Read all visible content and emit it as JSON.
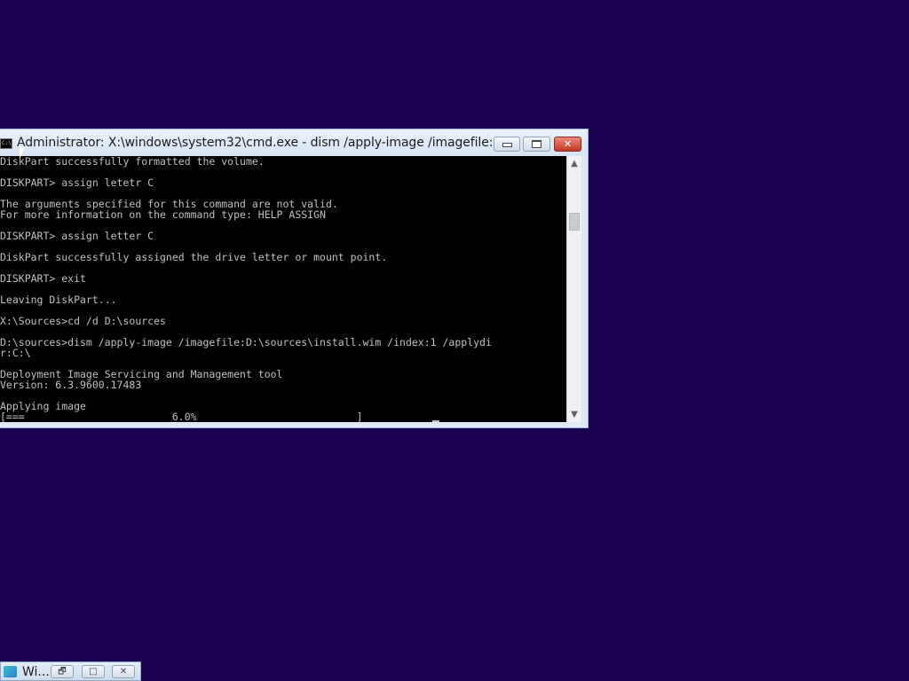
{
  "colors": {
    "desktop_background": "#1c0352",
    "console_background": "#000000",
    "console_text": "#c0c0c0",
    "close_button": "#c4392a"
  },
  "cmd_window": {
    "icon_name": "cmd-icon",
    "icon_label": "C:\\",
    "title": "Administrator: X:\\windows\\system32\\cmd.exe - dism  /apply-image /imagefile:...",
    "buttons": {
      "minimize_icon": "minimize-icon",
      "maximize_icon": "maximize-icon",
      "close_label": "✕"
    },
    "console_lines": [
      "DiskPart successfully formatted the volume.",
      "",
      "DISKPART> assign letetr C",
      "",
      "The arguments specified for this command are not valid.",
      "For more information on the command type: HELP ASSIGN",
      "",
      "DISKPART> assign letter C",
      "",
      "DiskPart successfully assigned the drive letter or mount point.",
      "",
      "DISKPART> exit",
      "",
      "Leaving DiskPart...",
      "",
      "X:\\Sources>cd /d D:\\sources",
      "",
      "D:\\sources>dism /apply-image /imagefile:D:\\sources\\install.wim /index:1 /applydi",
      "r:C:\\",
      "",
      "Deployment Image Servicing and Management tool",
      "Version: 6.3.9600.17483",
      "",
      "Applying image",
      "[===                        6.0%                          ] "
    ],
    "progress_percent": 6.0,
    "scrollbar": {
      "up_arrow": "▲",
      "down_arrow": "▼"
    }
  },
  "minimized_window": {
    "icon_name": "app-icon",
    "title": "Wi...",
    "restore_label": "🗗",
    "maximize_label": "□",
    "close_label": "✕"
  }
}
